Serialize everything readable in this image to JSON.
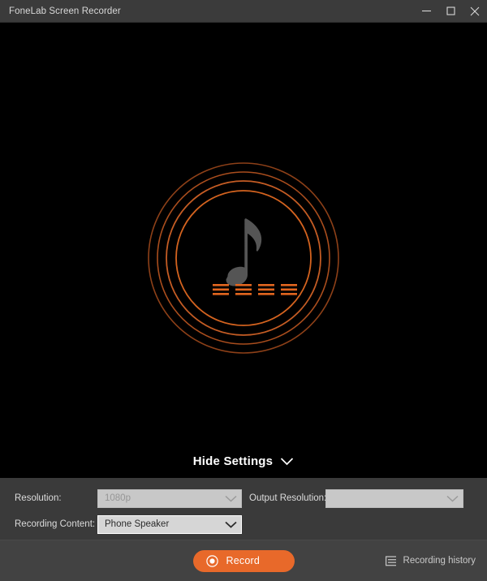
{
  "window": {
    "title": "FoneLab Screen Recorder",
    "controls": [
      {
        "name": "minimize",
        "glyph": "minimize-icon"
      },
      {
        "name": "maximize",
        "glyph": "maximize-icon"
      },
      {
        "name": "close",
        "glyph": "close-icon"
      }
    ]
  },
  "canvas": {
    "visual": "audio-recording-visualizer",
    "note_icon": "music-note-icon",
    "equalizer_icon": "equalizer-bars-icon",
    "ring_count": 4,
    "bar_groups": 4,
    "bars_per_group": 3
  },
  "settings_toggle": {
    "label": "Hide Settings",
    "chevron": "chevron-down-icon"
  },
  "settings": {
    "resolution": {
      "label": "Resolution:",
      "value": "1080p",
      "placeholder": "",
      "disabled": true,
      "chevron": "chevron-down-icon"
    },
    "output_resolution": {
      "label": "Output Resolution:",
      "value": "",
      "placeholder": "",
      "disabled": true,
      "chevron": "chevron-down-icon"
    },
    "recording_content": {
      "label": "Recording Content:",
      "value": "Phone Speaker",
      "placeholder": "",
      "disabled": false,
      "chevron": "chevron-down-icon"
    }
  },
  "bottom_bar": {
    "record_label": "Record",
    "record_icon": "record-dot-icon",
    "history_label": "Recording history",
    "history_icon": "list-lines-icon"
  },
  "colors": {
    "accent_orange": "#e8692a",
    "ring_orange": "#c05a25",
    "titlebar": "#3b3b3b",
    "settings_panel": "#3a3a3a",
    "bottom_bar": "#424242",
    "canvas": "#000000",
    "note_gray": "#555555"
  }
}
